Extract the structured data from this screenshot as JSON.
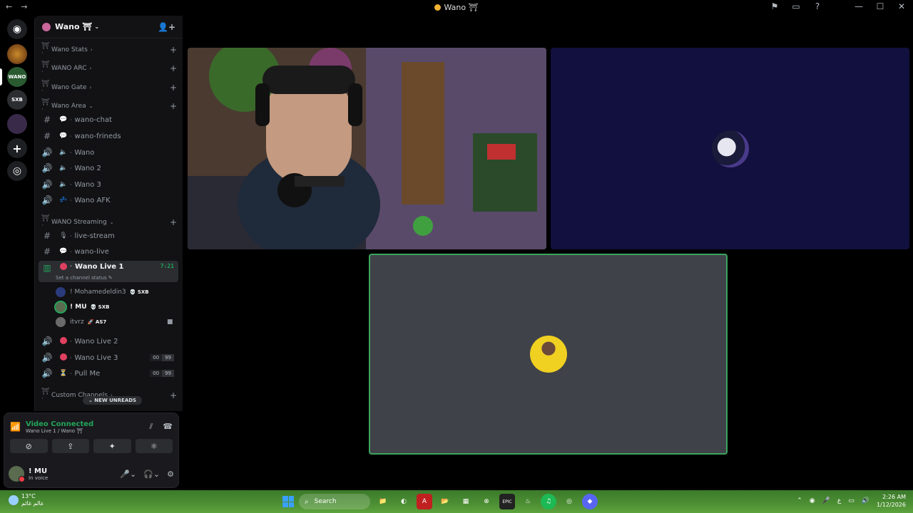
{
  "window": {
    "title": "Wano ⛩",
    "nav": {
      "back": "←",
      "forward": "→"
    },
    "controls": {
      "inbox": "⚑",
      "window": "▭",
      "help": "?",
      "minimize": "—",
      "maximize": "☐",
      "close": "✕"
    }
  },
  "rail": {
    "home": "◉",
    "servers": [
      "",
      "WANO",
      "SXB",
      ""
    ],
    "add": "+",
    "discover": "◎"
  },
  "guild": {
    "name": "Wano ⛩",
    "chevron": "⌄",
    "invite_icon": "👤+"
  },
  "categories": [
    {
      "name": "Wano Stats",
      "chevron": "›",
      "plus": "+"
    },
    {
      "name": "WANO ARC",
      "chevron": "›",
      "plus": "+"
    },
    {
      "name": "Wano Gate",
      "chevron": "›",
      "plus": "+"
    },
    {
      "name": "Wano Area",
      "chevron": "⌄",
      "plus": "+"
    },
    {
      "name": "WANO Streaming",
      "chevron": "⌄",
      "plus": "+"
    },
    {
      "name": "Custom Channels",
      "chevron": "›",
      "plus": "+"
    }
  ],
  "channels": [
    {
      "type": "#",
      "emoji": "💬",
      "name": "wano-chat"
    },
    {
      "type": "#",
      "emoji": "💬",
      "name": "wano-frineds"
    },
    {
      "type": "🔊",
      "emoji": "🔈",
      "name": "Wano"
    },
    {
      "type": "🔊",
      "emoji": "🔈",
      "name": "Wano 2"
    },
    {
      "type": "🔊",
      "emoji": "🔈",
      "name": "Wano 3"
    },
    {
      "type": "🔊",
      "emoji": "💤",
      "name": "Wano AFK"
    },
    {
      "type": "#",
      "emoji": "🎙",
      "name": "live-stream"
    },
    {
      "type": "#",
      "emoji": "💬",
      "name": "wano-live"
    },
    {
      "type": "▥",
      "emoji": "",
      "name": "Wano Live 1",
      "timer": "7:21"
    },
    {
      "type": "🔊",
      "emoji": "",
      "name": "Wano Live 2"
    },
    {
      "type": "🔊",
      "emoji": "",
      "name": "Wano Live 3",
      "count_a": "00",
      "count_b": "99"
    },
    {
      "type": "🔊",
      "emoji": "⏳",
      "name": "Pull Me",
      "count_a": "00",
      "count_b": "99"
    }
  ],
  "channel_status": "Set a channel status ✎",
  "voice_users": [
    {
      "name": "! Mohamedeldin3",
      "tag": "💀 SXB"
    },
    {
      "name": "! MU",
      "tag": "💀 SXB"
    },
    {
      "name": "itvrz",
      "tag": "🚀 AS7",
      "cam_icon": "■"
    }
  ],
  "new_unreads": "⌄  NEW UNREADS",
  "voice_panel": {
    "status": "Video Connected",
    "location": "Wano Live 1 / Wano ⛩",
    "signal_icon": "📶",
    "noise_icon": "⫽",
    "disconnect_icon": "☎",
    "buttons": [
      "⊘",
      "⇪",
      "✦",
      "⚛"
    ]
  },
  "user": {
    "name": "! MU",
    "status": "In voice",
    "mic": "🎤⌄",
    "headset": "🎧⌄",
    "settings": "⚙"
  },
  "taskbar": {
    "temperature": "13°C",
    "weather_text": "عالم غائم",
    "search_placeholder": "Search",
    "search_icon": "⌕",
    "apps": [
      "📁",
      "◐",
      "A",
      "📂",
      "▦",
      "⊗",
      "EPIC",
      "♨",
      "♫",
      "◎",
      "◆"
    ],
    "tray": [
      "⌃",
      "◉",
      "🎤",
      "ع",
      "▭",
      "🔊"
    ],
    "time": "2:26 AM",
    "date": "1/12/2026"
  }
}
